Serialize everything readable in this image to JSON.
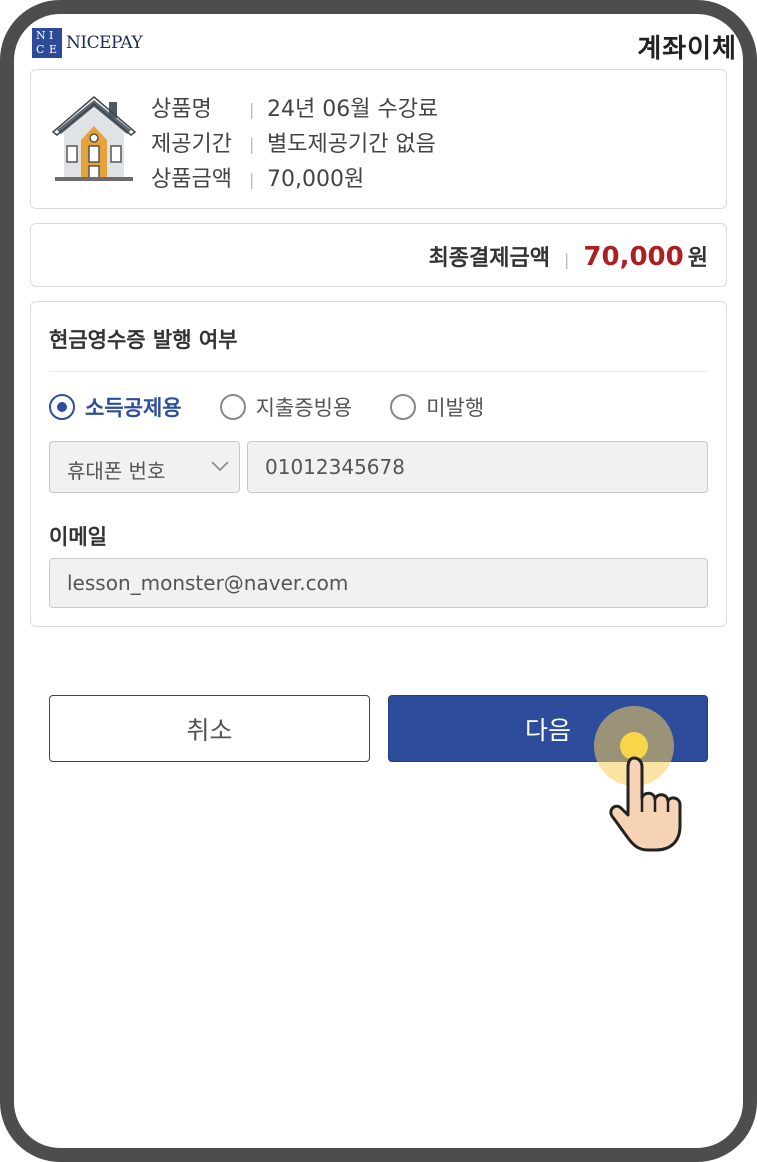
{
  "header": {
    "logo_letters": [
      "N",
      "I",
      "C",
      "E"
    ],
    "logo_text": "NICEPAY",
    "title": "계좌이체"
  },
  "product": {
    "icon": "house-icon",
    "rows": [
      {
        "label": "상품명",
        "value": "24년 06월 수강료"
      },
      {
        "label": "제공기간",
        "value": "별도제공기간 없음"
      },
      {
        "label": "상품금액",
        "value": "70,000원"
      }
    ]
  },
  "total": {
    "label": "최종결제금액",
    "amount": "70,000",
    "unit": "원",
    "amount_color": "#b01e22"
  },
  "receipt": {
    "title": "현금영수증 발행 여부",
    "options": [
      {
        "label": "소득공제용",
        "selected": true
      },
      {
        "label": "지출증빙용",
        "selected": false
      },
      {
        "label": "미발행",
        "selected": false
      }
    ],
    "id_type_selected": "휴대폰 번호",
    "phone_value": "01012345678",
    "email_label": "이메일",
    "email_value": "lesson_monster@naver.com"
  },
  "buttons": {
    "cancel_label": "취소",
    "next_label": "다음",
    "accent": "#2e4c9c"
  }
}
